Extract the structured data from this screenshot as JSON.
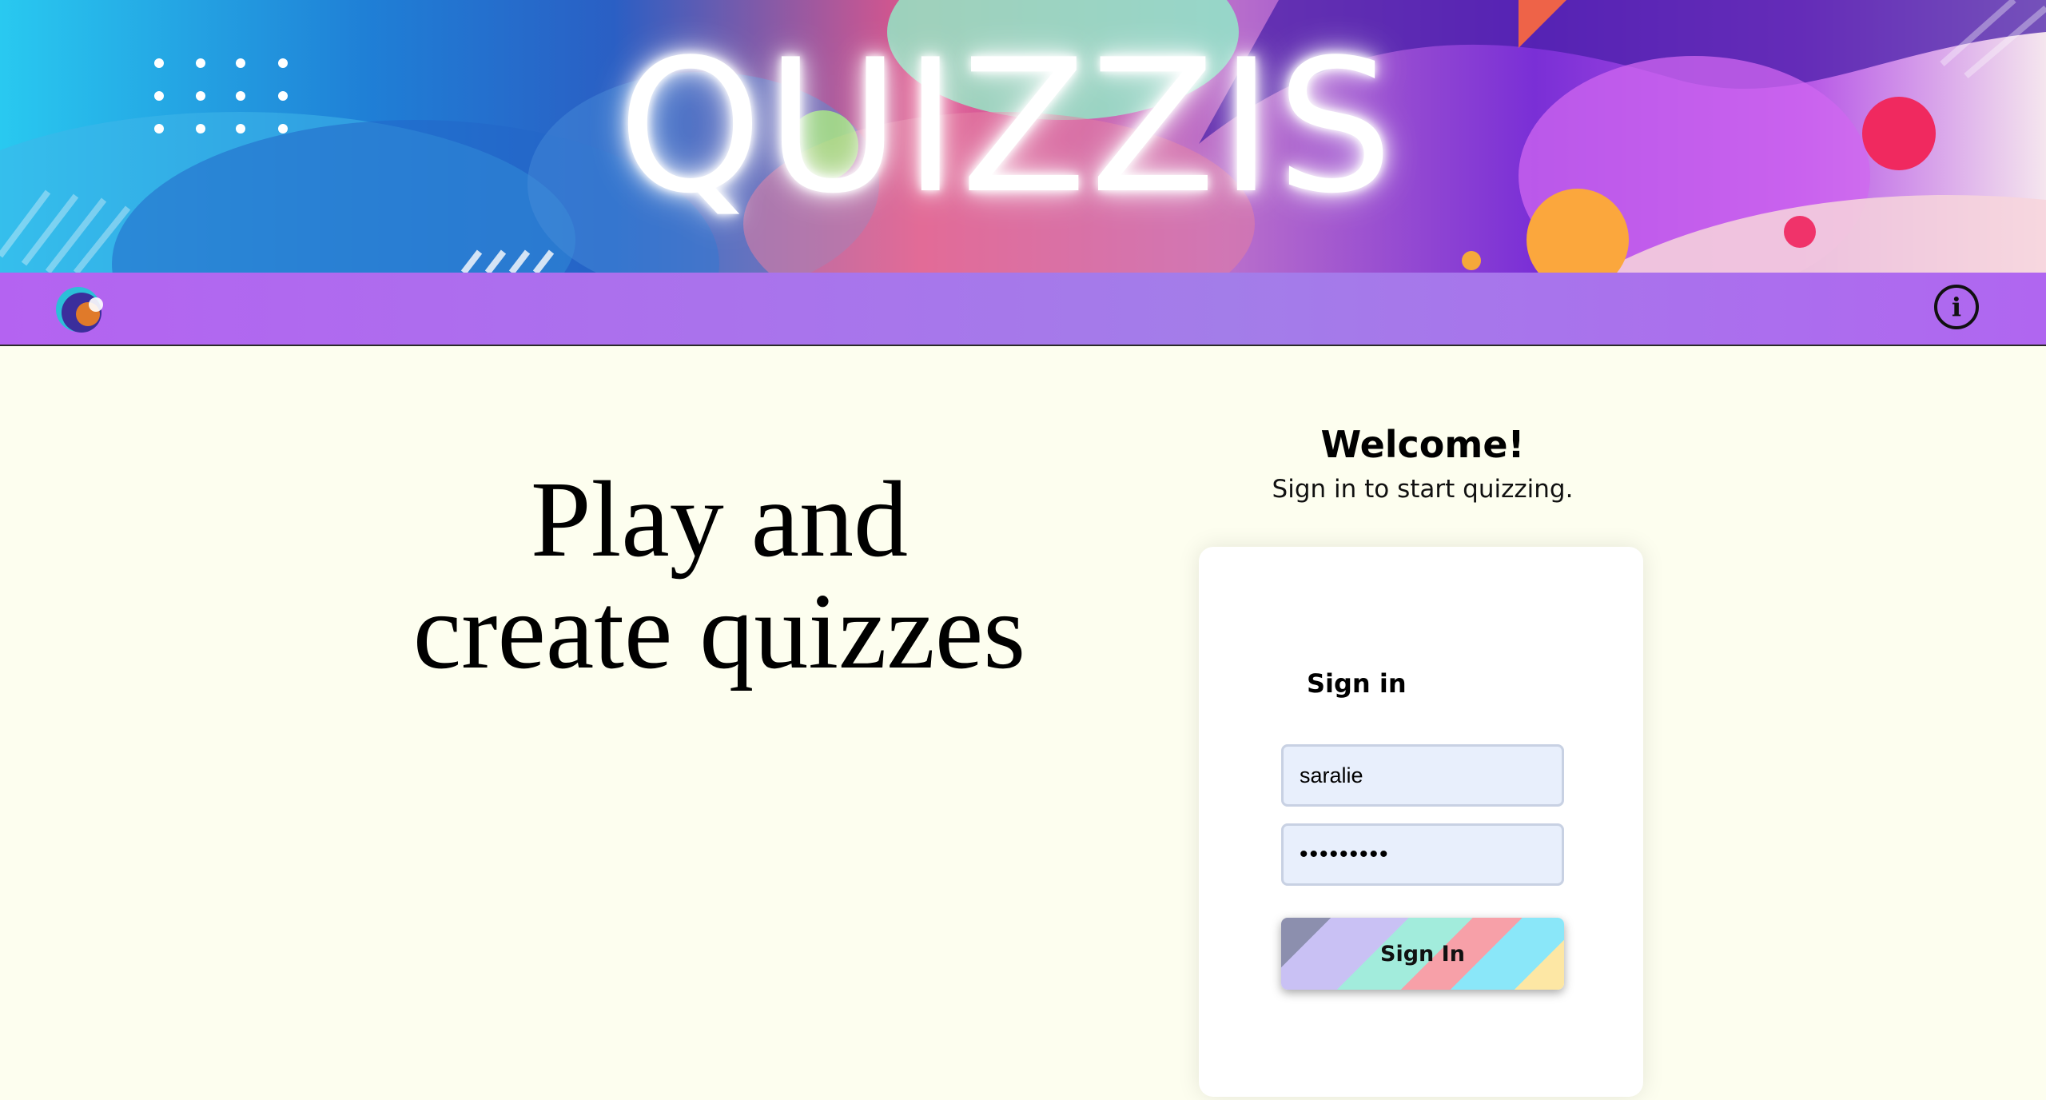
{
  "banner": {
    "title": "QUIZZIS"
  },
  "navbar": {
    "logo_icon": "app-logo-icon",
    "info_icon": "info-icon",
    "info_glyph": "i"
  },
  "hero": {
    "line1": "Play and",
    "line2": "create quizzes"
  },
  "welcome": {
    "title": "Welcome!",
    "subtitle": "Sign in to start quizzing."
  },
  "signin": {
    "heading": "Sign in",
    "username_value": "saralie",
    "password_value": "•••••••••",
    "button_label": "Sign In"
  },
  "colors": {
    "page_background": "#fdfeef",
    "navbar": "#b463f1",
    "card": "#ffffff",
    "input_background": "#e8effc"
  }
}
